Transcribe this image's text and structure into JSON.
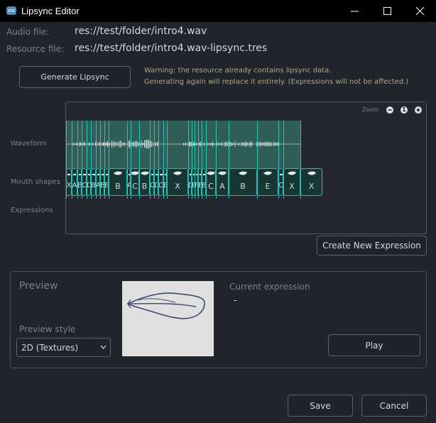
{
  "window": {
    "title": "Lipsync Editor",
    "colors": {
      "titlebar": "#000000",
      "background": "#20242c",
      "accent": "#21c1b8",
      "warning": "#b1a87e"
    }
  },
  "fields": {
    "audio_label": "Audio file:",
    "audio_value": "res://test/folder/intro4.wav",
    "resource_label": "Resource file:",
    "resource_value": "res://test/folder/intro4.wav-lipsync.tres"
  },
  "generate": {
    "button_label": "Generate Lipsync",
    "warning_line1": "Warning: the resource already contains lipsync data.",
    "warning_line2": "Generating again will replace it entirely. (Expressions will not be affected.)"
  },
  "timeline": {
    "zoom_label": "Zoom",
    "zoom_out_icon": "minus-circle-icon",
    "zoom_reset_label": "1",
    "zoom_in_icon": "plus-circle-icon",
    "rows": {
      "waveform": "Waveform",
      "mouth_shapes": "Mouth shapes",
      "expressions": "Expressions"
    },
    "mouth_shapes": [
      "X",
      "A",
      "B",
      "C",
      "D",
      "B",
      "A",
      "B",
      "E",
      "B",
      "A",
      "C",
      "B",
      "C",
      "D",
      "C",
      "B",
      "X",
      "D",
      "B",
      "F",
      "E",
      "B",
      "C",
      "A",
      "B",
      "E",
      "C",
      "X",
      "X"
    ]
  },
  "create_expression": {
    "button_label": "Create New Expression"
  },
  "preview": {
    "title": "Preview",
    "style_label": "Preview style",
    "style_value": "2D (Textures)",
    "current_expression_label": "Current expression",
    "current_expression_value": "-",
    "play_label": "Play"
  },
  "footer": {
    "save_label": "Save",
    "cancel_label": "Cancel"
  }
}
